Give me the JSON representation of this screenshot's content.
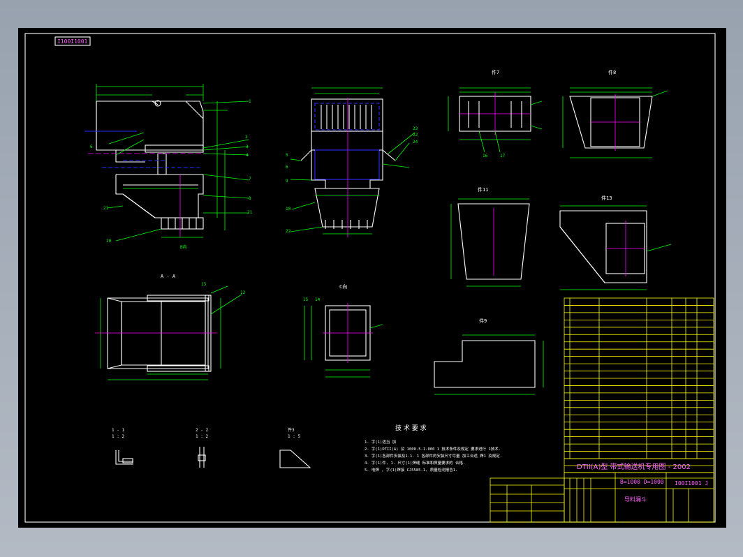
{
  "drawing": {
    "code_box": "I100I1001",
    "title_main": "DTII(A)型  带式输送机专用图 - 2002",
    "title_spec": "B=1000  D=1000",
    "title_code": "I00I1001 J",
    "part_name": "导料漏斗",
    "tech_heading": "技 术 要 求",
    "tech_notes": [
      "1. 字(1)适当 加",
      "2. 字(1)DTII(A) 及 1000.5-1.000 1 技术条件及规定 要求进行 1技术.",
      "3. 字(1)各部件安装及1.1. 1 各部件的安装尺寸尽量 加工合适 焊1 及规定.",
      "4. 字(1)件, 1.  尺寸(1)焊缝 标准和质量要求的 合格.",
      "5. 电焊 ,  字(1)焊接 CJ5585-1,   质量检测报告1."
    ]
  },
  "views": {
    "part7": "件7",
    "part8": "件8",
    "part11": "件11",
    "part13": "件13",
    "part9": "件9",
    "partA": "A - A",
    "partB": "B向",
    "partC": "C向",
    "sec11": "1 - 1",
    "sec22": "2 - 2",
    "part3": "件3",
    "scale_a": "1 : 2",
    "scale_b": "1 : 2",
    "scale_c": "1 : 5"
  },
  "callouts": [
    "1",
    "2",
    "3",
    "4",
    "5",
    "6",
    "7",
    "8",
    "9",
    "10",
    "11",
    "12",
    "13",
    "14",
    "15",
    "16",
    "17",
    "18",
    "19",
    "20",
    "21",
    "22",
    "23",
    "24"
  ],
  "bom_rows": 22,
  "colors": {
    "sheet": "#000000",
    "outline": "#ffffff",
    "dimension": "#00ff00",
    "centerline": "#ff00ff",
    "table": "#ffff00",
    "hidden": "#2d2dff"
  }
}
